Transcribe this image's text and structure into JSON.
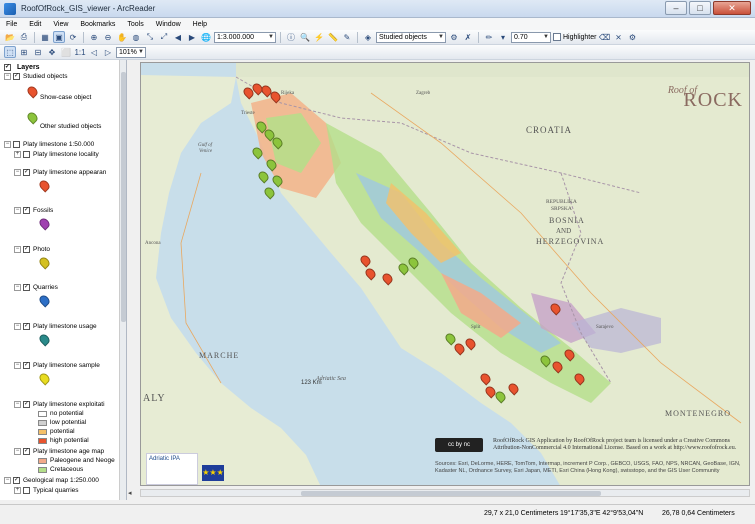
{
  "window": {
    "title": "RoofOfRock_GIS_viewer - ArcReader",
    "minimize": "–",
    "maximize": "□",
    "close": "✕"
  },
  "menu": [
    "File",
    "Edit",
    "View",
    "Bookmarks",
    "Tools",
    "Window",
    "Help"
  ],
  "toolbar": {
    "scale_value": "1:3.000.000",
    "layer_select": "Studied objects",
    "line_width": "0.70",
    "highlighter_label": "Highlighter",
    "zoom_percent": "101%"
  },
  "toc": {
    "root_label": "Layers",
    "items": [
      {
        "label": "Studied objects",
        "checked": true
      },
      {
        "label": "Show-case object",
        "symbol": "orange-marker"
      },
      {
        "label": "Other studied objects",
        "symbol": "green-marker"
      },
      {
        "label": "Platy limestone 1:50.000",
        "checked": false
      },
      {
        "label": "Platy limestone locality",
        "checked": false
      },
      {
        "label": "Platy limestone appearan",
        "checked": true
      },
      {
        "label": "Fossils",
        "checked": true
      },
      {
        "label": "Photo",
        "checked": true
      },
      {
        "label": "Quarries",
        "checked": true
      },
      {
        "label": "Platy limestone usage",
        "checked": true
      },
      {
        "label": "Platy limestone sample",
        "checked": true
      },
      {
        "label": "Platy limestone exploitati",
        "checked": true
      },
      {
        "label": "no potential"
      },
      {
        "label": "low potential"
      },
      {
        "label": "potential"
      },
      {
        "label": "high potential"
      },
      {
        "label": "Platy limestone age map",
        "checked": true
      },
      {
        "label": "Paleogene and Neoge"
      },
      {
        "label": "Cretaceous"
      },
      {
        "label": "Geological map 1:250.000",
        "checked": true
      },
      {
        "label": "Typical quarries",
        "checked": false
      }
    ],
    "colors": {
      "orange_marker": "#e8532e",
      "green_marker": "#8cc43c",
      "fossils": "#a040b0",
      "photo": "#d4c020",
      "quarries": "#2d6fc6",
      "usage": "#2a8a8a",
      "sample": "#e8dc20",
      "no_potential": "#ffffff",
      "low_potential": "#d0d0d0",
      "potential": "#f4c06a",
      "high_potential": "#e8532e",
      "paleogene": "#f3a98a",
      "cretaceous": "#b4df8a"
    }
  },
  "map": {
    "labels": {
      "croatia": "CROATIA",
      "bosnia1": "REPUBLIKA",
      "bosnia2": "SRPSKA",
      "bosnia3": "BOSNIA",
      "bosnia4": "AND",
      "bosnia5": "HERZEGOVINA",
      "adriatic": "Adriatic Sea",
      "gulf1": "Gulf of",
      "gulf2": "Venice",
      "marche": "MARCHE",
      "montenegro": "MONTENEGRO",
      "aly": "ALY",
      "trieste": "Trieste",
      "zagreb": "Zagreb",
      "sarajevo": "Sarajevo",
      "rijeka": "Rijeka",
      "ancona": "Ancona",
      "split": "Split",
      "roof_small": "Roof of",
      "roof_big": "ROCK",
      "scale": "123 Km",
      "cc_badge": "cc by nc"
    },
    "license": "RoofOfRock GIS Application by RoofOfRock project team is licensed under a Creative Commons Attribution-NonCommercial 4.0 International License. Based on a work at http://www.roofofrock.eu.",
    "attribution": "Sources: Esri, DeLorme, HERE, TomTom, Intermap, increment P Corp., GEBCO, USGS, FAO, NPS, NRCAN, GeoBase, IGN, Kadaster NL, Ordnance Survey, Esri Japan, METI, Esri China (Hong Kong), swisstopo, and the GIS User Community",
    "adriatic_logo": "Adriatic IPA",
    "eu_flag": "★★★"
  },
  "status": {
    "page_size": "29,7 x 21,0 Centimeters",
    "coordinates": "19°17'35,3\"E 42°9'53,04\"N",
    "position": "26,78  0,64 Centimeters"
  }
}
